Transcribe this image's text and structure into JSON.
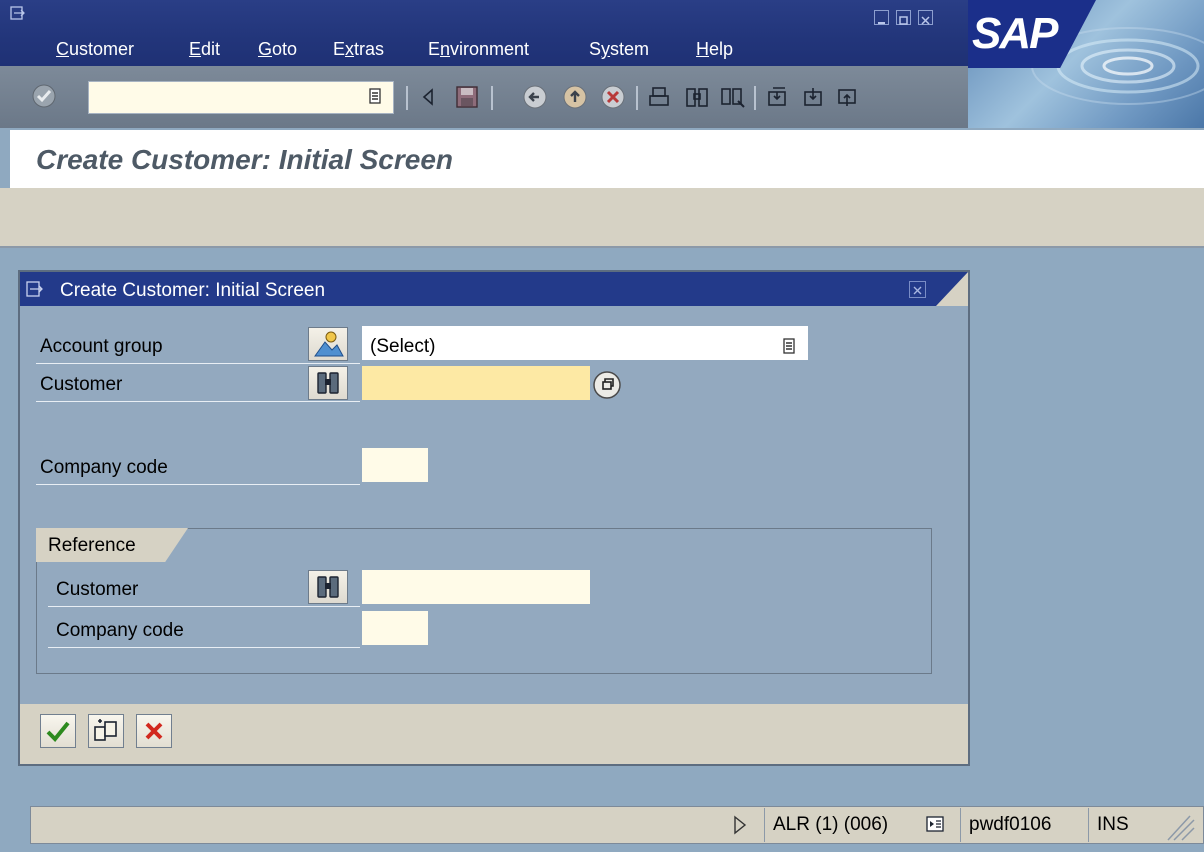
{
  "menu": {
    "items": [
      {
        "label": "Customer",
        "mnemonic": "C",
        "rest": "ustomer"
      },
      {
        "label": "Edit",
        "mnemonic": "E",
        "rest": "dit"
      },
      {
        "label": "Goto",
        "mnemonic": "G",
        "rest": "oto"
      },
      {
        "label": "Extras",
        "pre": "E",
        "mnemonic": "x",
        "rest": "tras"
      },
      {
        "label": "Environment",
        "pre": "E",
        "mnemonic": "n",
        "rest": "vironment"
      },
      {
        "label": "System",
        "pre": "S",
        "mnemonic": "y",
        "rest": "stem"
      },
      {
        "label": "Help",
        "mnemonic": "H",
        "rest": "elp"
      }
    ],
    "logo": "SAP"
  },
  "toolbar": {
    "command_field_value": "",
    "icons": [
      "back-arrow-icon",
      "save-icon",
      "back-icon",
      "exit-icon",
      "cancel-icon",
      "print-icon",
      "find-icon",
      "find-next-icon",
      "first-page-icon",
      "previous-page-icon",
      "next-page-icon"
    ]
  },
  "page": {
    "title": "Create Customer: Initial Screen"
  },
  "dialog": {
    "title": "Create Customer: Initial Screen",
    "fields": {
      "account_group_label": "Account group",
      "account_group_value": "(Select)",
      "customer_label": "Customer",
      "customer_value": "",
      "company_code_label": "Company code",
      "company_code_value": ""
    },
    "reference": {
      "title": "Reference",
      "customer_label": "Customer",
      "customer_value": "",
      "company_code_label": "Company code",
      "company_code_value": ""
    },
    "footer_buttons": [
      "continue-icon",
      "create-icon",
      "cancel-icon"
    ]
  },
  "status": {
    "system": "ALR (1) (006)",
    "server": "pwdf0106",
    "mode": "INS"
  },
  "colors": {
    "menu_bg": "#22357a",
    "dialog_title_bg": "#233a8a",
    "required_field": "#fde9a4",
    "input_field": "#fffbe8"
  }
}
